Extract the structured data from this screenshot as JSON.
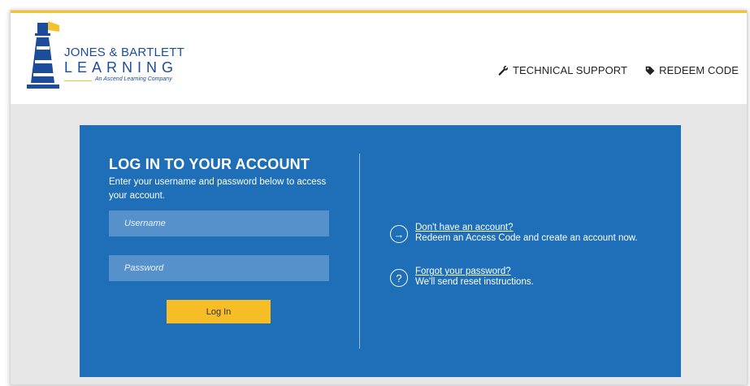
{
  "brand": {
    "line1": "JONES & BARTLETT",
    "line2": "LEARNING",
    "tagline": "An Ascend Learning Company",
    "colors": {
      "blue": "#1b4d9b",
      "yellow": "#f6c22b"
    }
  },
  "nav": {
    "support": {
      "label": "TECHNICAL SUPPORT",
      "icon": "wrench-icon"
    },
    "redeem": {
      "label": "REDEEM CODE",
      "icon": "tag-icon"
    }
  },
  "login": {
    "title": "LOG IN TO YOUR ACCOUNT",
    "subtitle": "Enter your username and password below to access your account.",
    "username_placeholder": "Username",
    "password_placeholder": "Password",
    "button_label": "Log In"
  },
  "links": {
    "signup": {
      "link": "Don't have an account?",
      "desc": "Redeem an Access Code and create an account now.",
      "icon": "arrow-right-circle-icon"
    },
    "forgot": {
      "link": "Forgot your password?",
      "desc": "We'll send reset instructions.",
      "icon": "question-circle-icon"
    }
  },
  "colors": {
    "panel": "#1e6fb8",
    "input": "#5791cc",
    "button": "#f6bd26",
    "background": "#e6e6e6"
  }
}
